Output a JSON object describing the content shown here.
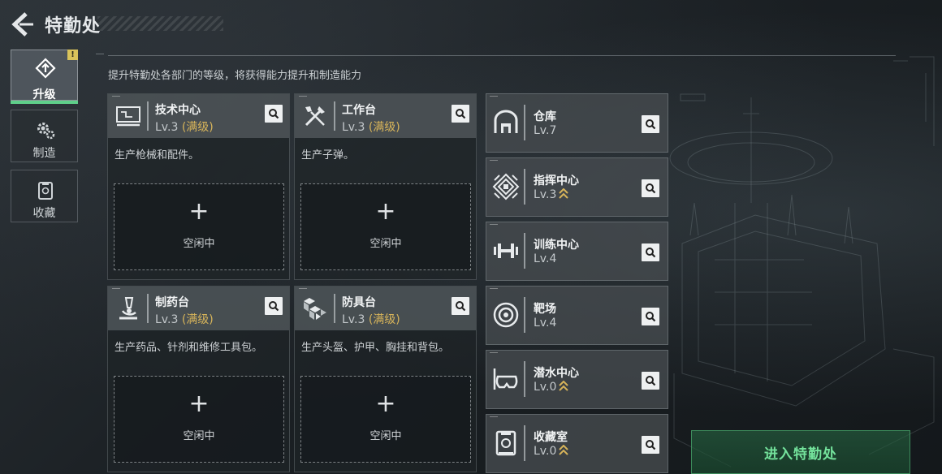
{
  "header": {
    "title": "特勤处"
  },
  "nav": {
    "items": [
      {
        "label": "升级",
        "icon": "upgrade-icon"
      },
      {
        "label": "制造",
        "icon": "gear-icon"
      },
      {
        "label": "收藏",
        "icon": "collection-icon"
      }
    ],
    "badge": "!"
  },
  "description": "提升特勤处各部门的等级，将获得能力提升和制造能力",
  "facilities": [
    {
      "name": "技术中心",
      "level": "Lv.3",
      "status": "(满级)",
      "desc": "生产枪械和配件。",
      "slot_label": "空闲中",
      "icon": "computer-icon"
    },
    {
      "name": "工作台",
      "level": "Lv.3",
      "status": "(满级)",
      "desc": "生产子弹。",
      "slot_label": "空闲中",
      "icon": "tools-icon"
    },
    {
      "name": "制药台",
      "level": "Lv.3",
      "status": "(满级)",
      "desc": "生产药品、针剂和维修工具包。",
      "slot_label": "空闲中",
      "icon": "microscope-icon"
    },
    {
      "name": "防具台",
      "level": "Lv.3",
      "status": "(满级)",
      "desc": "生产头盔、护甲、胸挂和背包。",
      "slot_label": "空闲中",
      "icon": "armor-icon"
    }
  ],
  "departments": [
    {
      "name": "仓库",
      "level": "Lv.7",
      "upgradable": false,
      "icon": "warehouse-icon"
    },
    {
      "name": "指挥中心",
      "level": "Lv.3",
      "upgradable": true,
      "icon": "command-icon"
    },
    {
      "name": "训练中心",
      "level": "Lv.4",
      "upgradable": false,
      "icon": "dumbbell-icon"
    },
    {
      "name": "靶场",
      "level": "Lv.4",
      "upgradable": false,
      "icon": "target-icon"
    },
    {
      "name": "潜水中心",
      "level": "Lv.0",
      "upgradable": true,
      "icon": "diving-mask-icon"
    },
    {
      "name": "收藏室",
      "level": "Lv.0",
      "upgradable": true,
      "icon": "collection-room-icon"
    }
  ],
  "enter_button": {
    "label": "进入特勤处"
  },
  "colors": {
    "accent_green": "#74e39c",
    "max_level": "#d7b45a",
    "badge_yellow": "#d9c35b"
  }
}
